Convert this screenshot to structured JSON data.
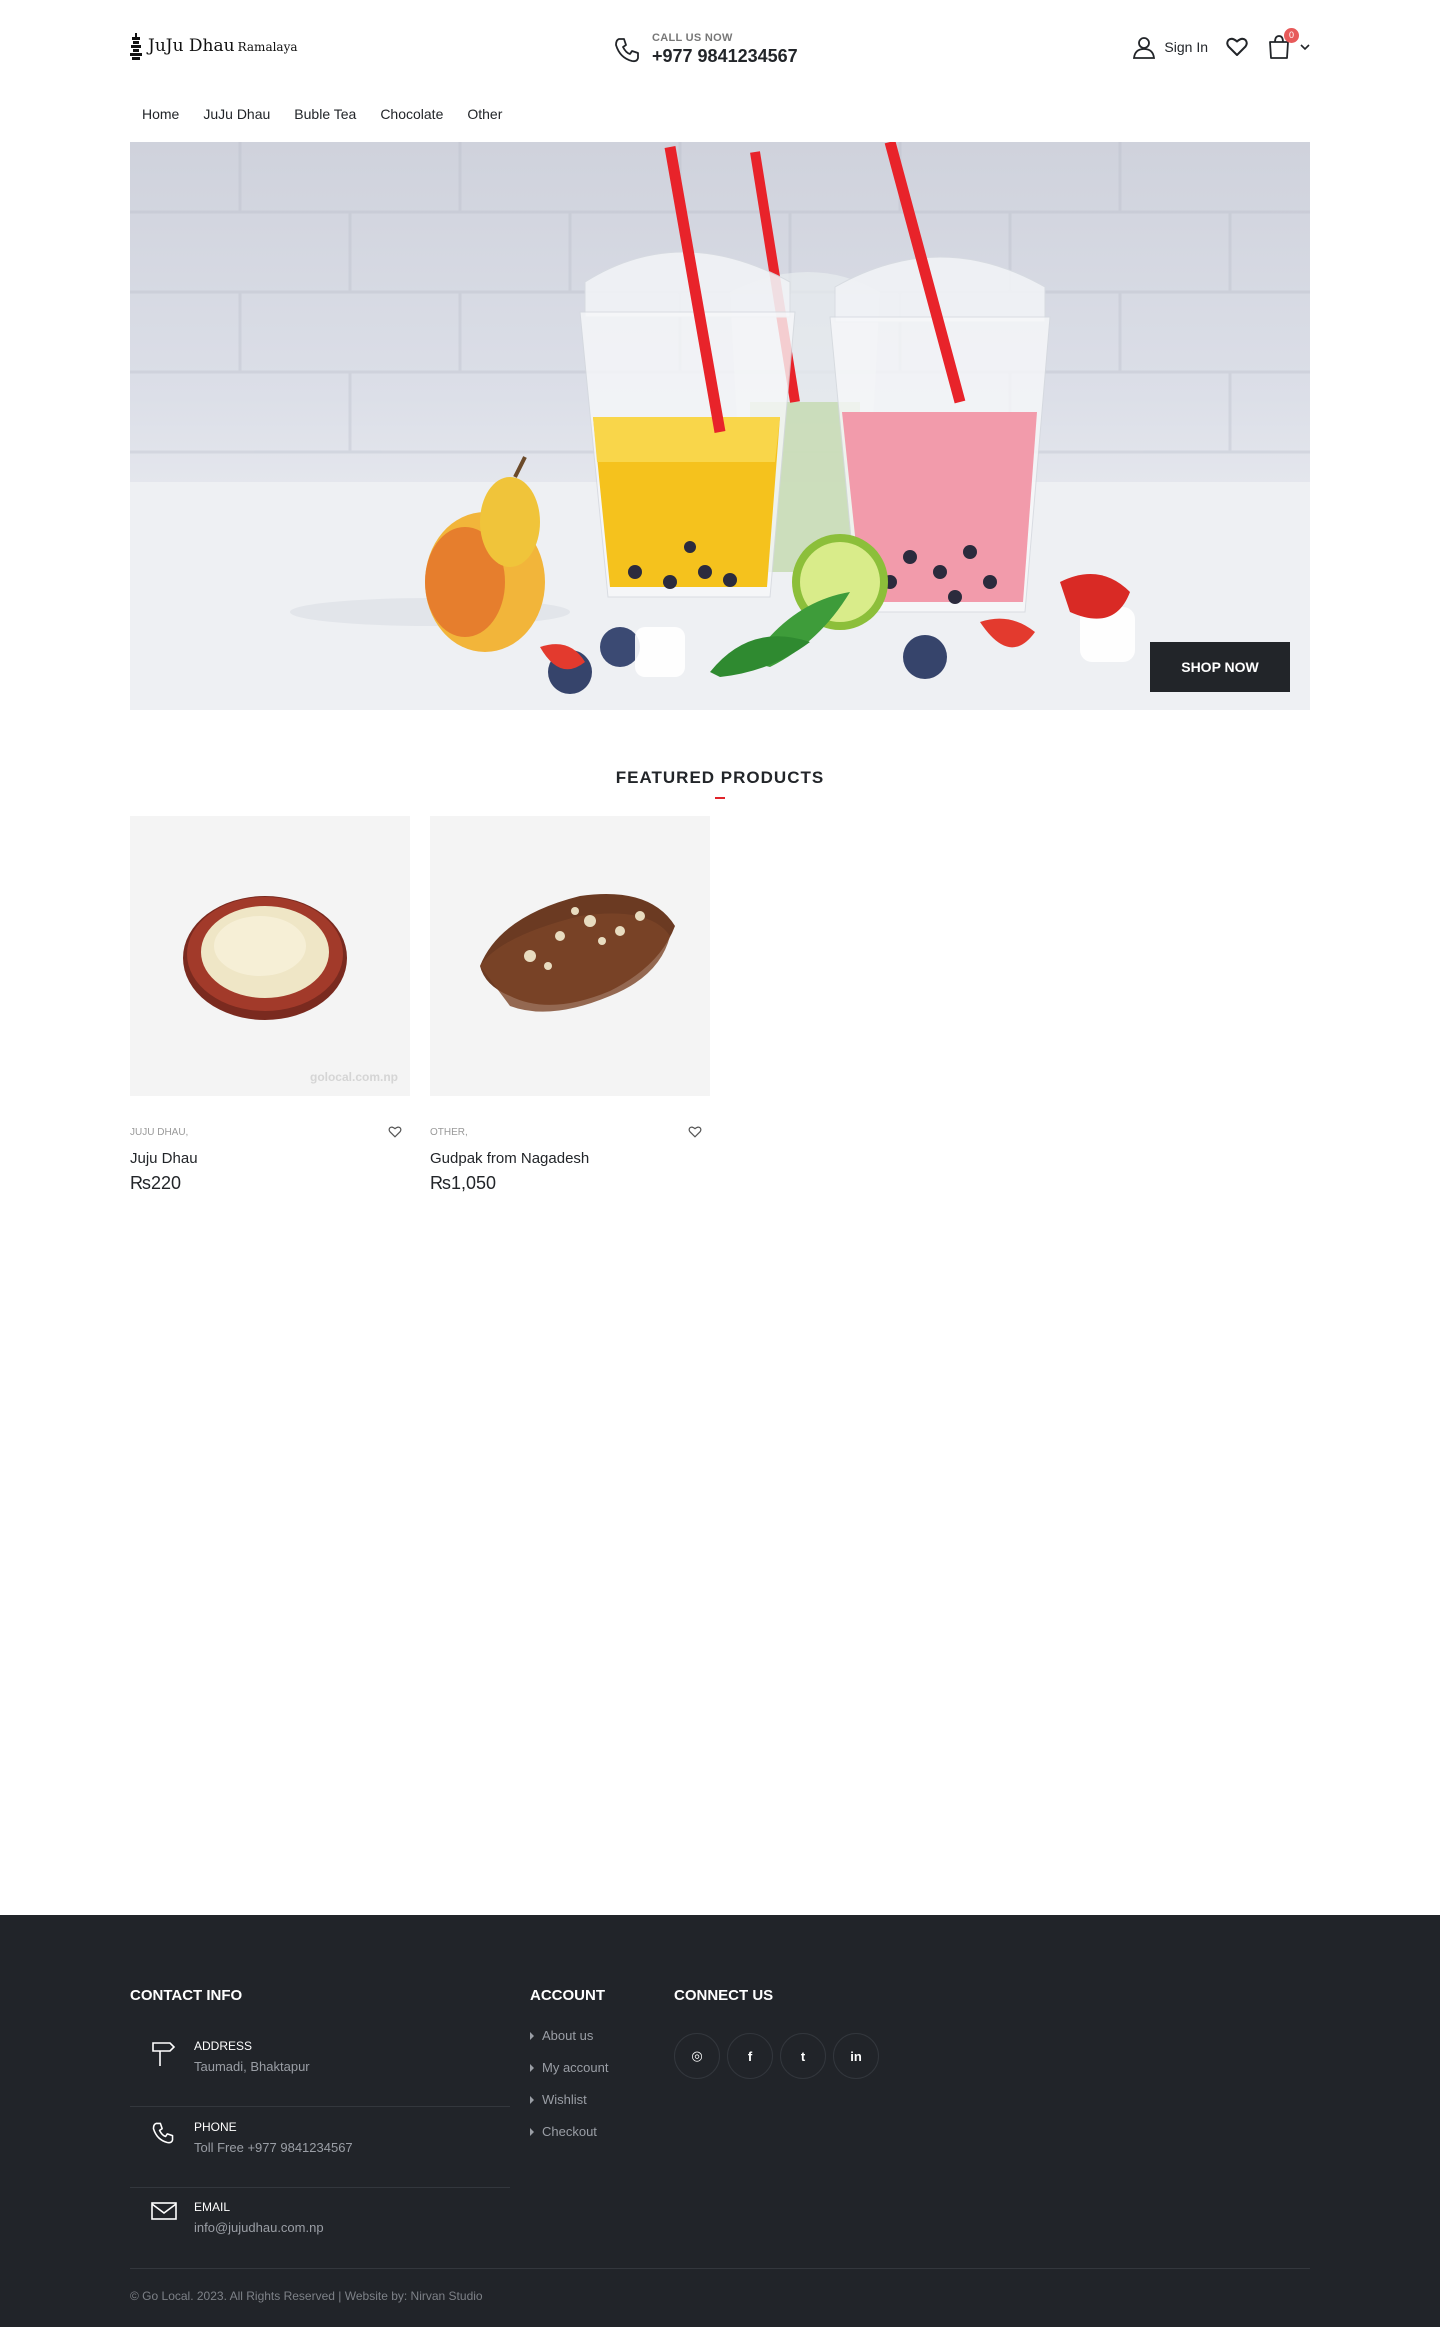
{
  "brand": {
    "name": "JuJu Dhau",
    "sub": "Ramalaya"
  },
  "header": {
    "call_label": "CALL US NOW",
    "call_number": "+977 9841234567",
    "signin_label": "Sign In",
    "cart_count": "0"
  },
  "nav": {
    "items": [
      "Home",
      "JuJu Dhau",
      "Buble Tea",
      "Chocolate",
      "Other"
    ]
  },
  "hero": {
    "button_label": "SHOP NOW"
  },
  "featured": {
    "title": "FEATURED PRODUCTS",
    "products": [
      {
        "category": "JUJU DHAU,",
        "name": "Juju Dhau",
        "price": "₨220",
        "watermark": "golocal.com.np"
      },
      {
        "category": "OTHER,",
        "name": "Gudpak from Nagadesh",
        "price": "₨1,050"
      }
    ]
  },
  "footer": {
    "contact_title": "CONTACT INFO",
    "contact": [
      {
        "label": "ADDRESS",
        "value": "Taumadi, Bhaktapur",
        "icon": "signpost-icon"
      },
      {
        "label": "PHONE",
        "value": "Toll Free +977 9841234567",
        "icon": "phone-icon"
      },
      {
        "label": "EMAIL",
        "value": "info@jujudhau.com.np",
        "icon": "envelope-icon"
      }
    ],
    "account_title": "ACCOUNT",
    "account_links": [
      "About us",
      "My account",
      "Wishlist",
      "Checkout"
    ],
    "connect_title": "CONNECT US",
    "social": [
      {
        "name": "instagram-icon",
        "glyph": "◎"
      },
      {
        "name": "facebook-icon",
        "glyph": "f"
      },
      {
        "name": "twitter-icon",
        "glyph": "t"
      },
      {
        "name": "linkedin-icon",
        "glyph": "in"
      }
    ],
    "copyright": "© Go Local. 2023. All Rights Reserved | Website by: Nirvan Studio"
  },
  "colors": {
    "dark": "#222529",
    "footer_bg": "#212429",
    "accent_red": "#e0242b",
    "badge": "#e75a5a"
  }
}
